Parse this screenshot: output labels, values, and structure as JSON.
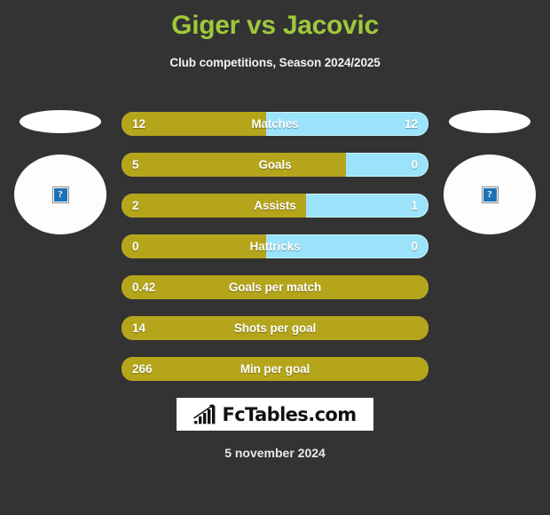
{
  "header": {
    "title": "Giger vs Jacovic",
    "subtitle": "Club competitions, Season 2024/2025",
    "title_color": "#9fc83c"
  },
  "players": {
    "left": {
      "avatar_placeholder": "?"
    },
    "right": {
      "avatar_placeholder": "?"
    }
  },
  "colors": {
    "background": "#333333",
    "home_bar": "#b5a51b",
    "away_bar": "#9ae3fa",
    "title": "#9fc83c",
    "text": "#ffffff"
  },
  "chart_data": {
    "type": "bar",
    "title": "Giger vs Jacovic",
    "subtitle": "Club competitions, Season 2024/2025",
    "orientation": "horizontal-diverging",
    "series": [
      {
        "name": "Giger",
        "color": "#b5a51b",
        "side": "left"
      },
      {
        "name": "Jacovic",
        "color": "#9ae3fa",
        "side": "right"
      }
    ],
    "categories": [
      "Matches",
      "Goals",
      "Assists",
      "Hattricks",
      "Goals per match",
      "Shots per goal",
      "Min per goal"
    ],
    "rows": [
      {
        "label": "Matches",
        "left_value": "12",
        "right_value": "12",
        "left_pct": 47,
        "single": false
      },
      {
        "label": "Goals",
        "left_value": "5",
        "right_value": "0",
        "left_pct": 73,
        "single": false
      },
      {
        "label": "Assists",
        "left_value": "2",
        "right_value": "1",
        "left_pct": 60,
        "single": false
      },
      {
        "label": "Hattricks",
        "left_value": "0",
        "right_value": "0",
        "left_pct": 47,
        "single": false
      },
      {
        "label": "Goals per match",
        "left_value": "0.42",
        "right_value": "",
        "left_pct": 100,
        "single": true
      },
      {
        "label": "Shots per goal",
        "left_value": "14",
        "right_value": "",
        "left_pct": 100,
        "single": true
      },
      {
        "label": "Min per goal",
        "left_value": "266",
        "right_value": "",
        "left_pct": 100,
        "single": true
      }
    ]
  },
  "logo": {
    "text": "FcTables.com",
    "icon": "bar-chart-arrow-icon"
  },
  "footer": {
    "date": "5 november 2024"
  }
}
